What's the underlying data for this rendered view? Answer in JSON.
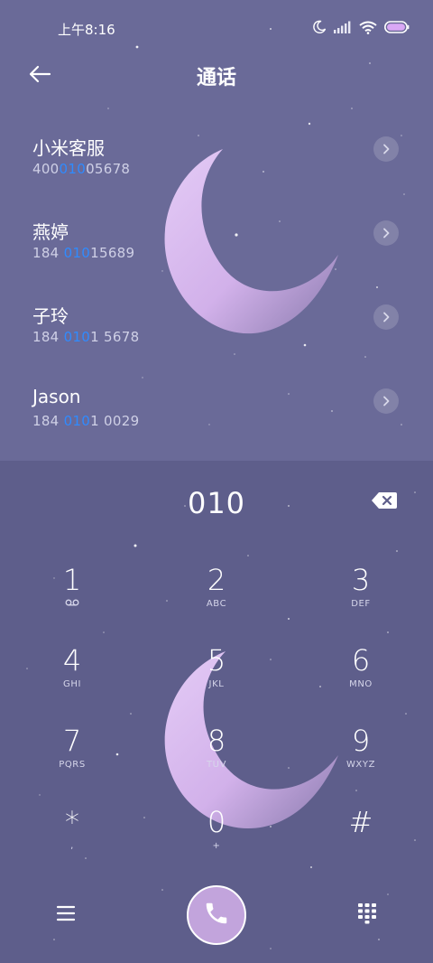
{
  "status_bar": {
    "time": "上午8:16",
    "icons": [
      "moon-icon",
      "signal-icon",
      "wifi-icon",
      "battery-icon"
    ]
  },
  "header": {
    "title": "通话",
    "back_icon": "back-arrow-icon"
  },
  "contacts": [
    {
      "name": "小米客服",
      "number_pre": "400",
      "number_match": "010",
      "number_post": "05678"
    },
    {
      "name": "燕婷",
      "number_pre": "184 ",
      "number_match": "010",
      "number_post": "15689"
    },
    {
      "name": "子玲",
      "number_pre": "184 ",
      "number_match": "010",
      "number_post": "1 5678"
    },
    {
      "name": "Jason",
      "number_pre": "184 ",
      "number_match": "010",
      "number_post": "1 0029"
    }
  ],
  "dialer": {
    "input": "010",
    "keys": [
      {
        "digit": "1",
        "letters": ""
      },
      {
        "digit": "2",
        "letters": "ABC"
      },
      {
        "digit": "3",
        "letters": "DEF"
      },
      {
        "digit": "4",
        "letters": "GHI"
      },
      {
        "digit": "5",
        "letters": "JKL"
      },
      {
        "digit": "6",
        "letters": "MNO"
      },
      {
        "digit": "7",
        "letters": "PQRS"
      },
      {
        "digit": "8",
        "letters": "TUV"
      },
      {
        "digit": "9",
        "letters": "WXYZ"
      },
      {
        "digit": "*",
        "letters": ","
      },
      {
        "digit": "0",
        "letters": "+"
      },
      {
        "digit": "#",
        "letters": ""
      }
    ]
  },
  "colors": {
    "background": "#6a6a98",
    "dial_panel": "#5e5e8b",
    "match_highlight": "#2f8bff",
    "call_button": "#c2a4dc",
    "moon": "#d9bff0"
  }
}
